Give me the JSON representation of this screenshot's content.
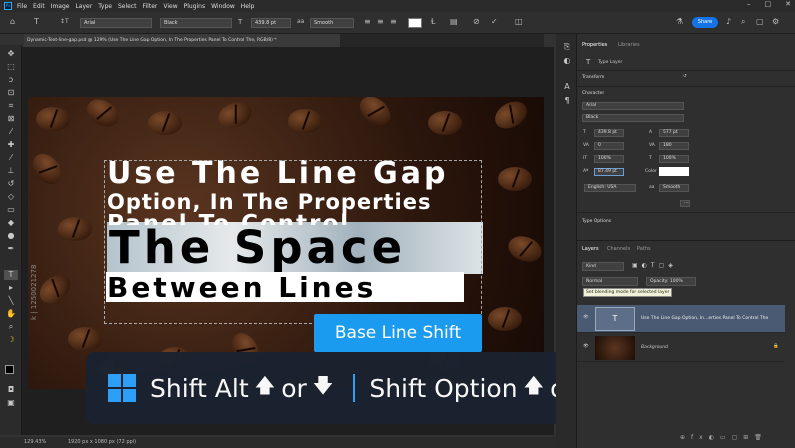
{
  "menu": [
    "File",
    "Edit",
    "Image",
    "Layer",
    "Type",
    "Select",
    "Filter",
    "View",
    "Plugins",
    "Window",
    "Help"
  ],
  "options": {
    "font_family": "Arial",
    "font_style": "Black",
    "font_size": "439.8 pt",
    "antialias": "Smooth",
    "share": "Share"
  },
  "document_tab": "Dynamic-Text-line-gap.psd @ 129% (Use The Line Gap Option, In The Properties Panel To Control The, RGB/8) *",
  "canvas_text": {
    "line1": "Use The Line Gap",
    "line2": "Option, In The Properties",
    "line3": "Panel To Control",
    "line4": "The Space",
    "line5": "Between Lines"
  },
  "base_line_shift": "Base Line Shift",
  "shortcut": {
    "win_combo": "Shift Alt",
    "mac_combo": "Shift Option",
    "or": "or"
  },
  "properties": {
    "tab_properties": "Properties",
    "tab_libraries": "Libraries",
    "type_layer": "Type Layer",
    "transform": "Transform",
    "character": "Character",
    "font": "Arial",
    "style": "Black",
    "size": "439.8 pt",
    "leading": "577 pt",
    "kerning": "0",
    "tracking": "180",
    "vscale": "100%",
    "hscale": "100%",
    "baseline": "87.49 pt",
    "color_label": "Color",
    "language": "English: USA",
    "aa": "Smooth",
    "type_options": "Type Options"
  },
  "layers": {
    "tab_layers": "Layers",
    "tab_channels": "Channels",
    "tab_paths": "Paths",
    "kind": "Kind",
    "blend": "Normal",
    "opacity": "Opacity: 100%",
    "tooltip": "Set blending mode for selected layer",
    "text_layer": "Use The Line Gap Option, In...erties Panel To Control The",
    "bg_layer": "Background"
  },
  "status": {
    "zoom": "129.43%",
    "size": "1920 px x 1080 px (72 ppi)"
  },
  "colors": {
    "accent": "#1a9bf0",
    "share": "#1473e6",
    "win": "#2ea4ff"
  }
}
